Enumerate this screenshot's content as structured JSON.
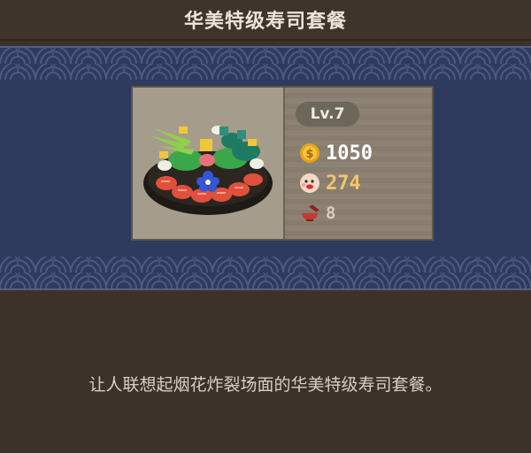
{
  "header": {
    "title": "华美特级寿司套餐"
  },
  "item": {
    "level": "Lv.7",
    "coins": "1050",
    "rating": "274",
    "bowls": "8",
    "image": "sushi-platter-icon",
    "icons": {
      "coins": "coin-icon",
      "rating": "taste-face-icon",
      "bowls": "rice-bowl-icon"
    }
  },
  "description": "让人联想起烟花炸裂场面的华美特级寿司套餐。",
  "colors": {
    "background": "#3c3229",
    "band": "#2e3a5e",
    "card": "#8a7f70",
    "food_box": "#a69c8c",
    "coins_text": "#ffffff",
    "rating_text": "#f2c66a",
    "bowls_text": "#d9cfc0"
  }
}
